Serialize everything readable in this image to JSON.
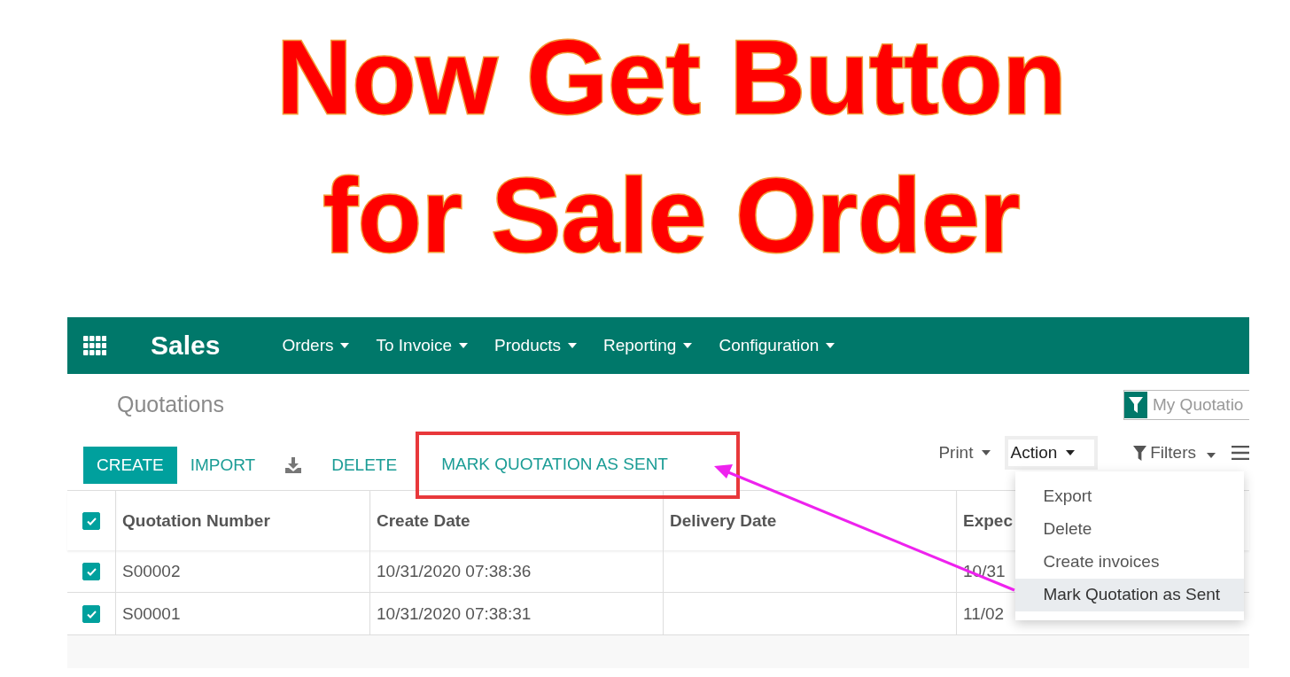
{
  "title_lines": [
    "Now Get Button",
    "for Sale Order"
  ],
  "app": {
    "name": "Sales",
    "menus": [
      "Orders",
      "To Invoice",
      "Products",
      "Reporting",
      "Configuration"
    ]
  },
  "breadcrumb": "Quotations",
  "facet": {
    "label": "My Quotatio"
  },
  "buttons": [
    {
      "label": "CREATE",
      "kind": "primary",
      "highlighted": false
    },
    {
      "label": "IMPORT",
      "kind": "link",
      "highlighted": false
    },
    {
      "kind": "download",
      "highlighted": false
    },
    {
      "label": "DELETE",
      "kind": "link",
      "highlighted": false
    },
    {
      "label": "MARK QUOTATION AS SENT",
      "kind": "link",
      "highlighted": true
    }
  ],
  "dropdowns": [
    {
      "label": "Print",
      "open": false
    },
    {
      "label": "Action",
      "open": true
    }
  ],
  "filters": {
    "label": "Filters"
  },
  "action_menu": [
    {
      "label": "Export",
      "selected": false
    },
    {
      "label": "Delete",
      "selected": false
    },
    {
      "label": "Create invoices",
      "selected": false
    },
    {
      "label": "Mark Quotation as Sent",
      "selected": true
    }
  ],
  "table": {
    "select_all": true,
    "columns": [
      "Quotation Number",
      "Create Date",
      "Delivery Date",
      "Expec"
    ],
    "rows": [
      {
        "checked": true,
        "cells": [
          "S00002",
          "10/31/2020 07:38:36",
          "",
          "10/31"
        ]
      },
      {
        "checked": true,
        "cells": [
          "S00001",
          "10/31/2020 07:38:31",
          "",
          "11/02"
        ]
      }
    ]
  }
}
